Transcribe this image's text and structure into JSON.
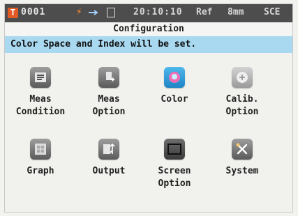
{
  "status": {
    "sample": "0001",
    "time": "20:10:10",
    "ref": "Ref",
    "aperture": "8mm",
    "mode": "SCE"
  },
  "header": {
    "title": "Configuration",
    "description": "Color Space and Index will be set."
  },
  "menu": [
    {
      "label": "Meas\nCondition",
      "icon": "meas-condition-icon"
    },
    {
      "label": "Meas\nOption",
      "icon": "meas-option-icon"
    },
    {
      "label": "Color",
      "icon": "color-icon"
    },
    {
      "label": "Calib.\nOption",
      "icon": "calib-option-icon"
    },
    {
      "label": "Graph",
      "icon": "graph-icon"
    },
    {
      "label": "Output",
      "icon": "usb-output-icon"
    },
    {
      "label": "Screen\nOption",
      "icon": "screen-option-icon"
    },
    {
      "label": "System",
      "icon": "system-tools-icon"
    }
  ],
  "colors": {
    "status_bar": "#4d4d4d",
    "description_bar": "#a9d9f1",
    "sample_icon": "#e15a23"
  }
}
